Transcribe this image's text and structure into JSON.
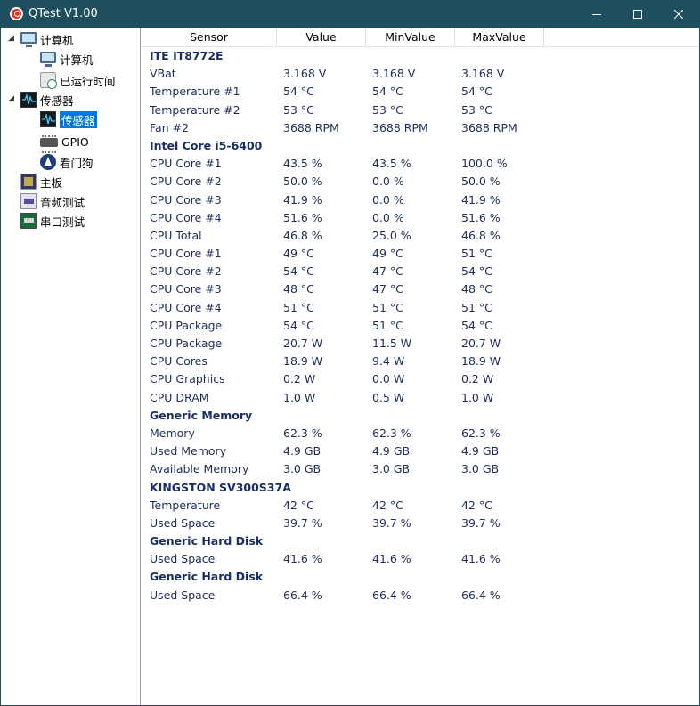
{
  "window": {
    "title": "QTest V1.00",
    "minimize_symbol": "",
    "maximize_symbol": "",
    "close_symbol": ""
  },
  "tree": [
    {
      "label": "计算机",
      "icon": "monitor-icon",
      "expander": "◢",
      "level": 0,
      "selected": false
    },
    {
      "label": "计算机",
      "icon": "monitor-icon",
      "level": 1,
      "selected": false
    },
    {
      "label": "已运行时间",
      "icon": "clock-icon",
      "level": 1,
      "selected": false
    },
    {
      "label": "传感器",
      "icon": "sensor-icon",
      "expander": "◢",
      "level": 0,
      "selected": false
    },
    {
      "label": "传感器",
      "icon": "sensor-icon",
      "level": 1,
      "selected": true
    },
    {
      "label": "GPIO",
      "icon": "chip-icon",
      "level": 1,
      "selected": false
    },
    {
      "label": "看门狗",
      "icon": "watchdog-icon",
      "level": 1,
      "selected": false
    },
    {
      "label": "主板",
      "icon": "mainboard-icon",
      "level": 0,
      "selected": false
    },
    {
      "label": "音频测试",
      "icon": "audio-icon",
      "level": 0,
      "selected": false
    },
    {
      "label": "串口测试",
      "icon": "serial-port-icon",
      "level": 0,
      "selected": false
    }
  ],
  "table": {
    "columns": [
      "Sensor",
      "Value",
      "MinValue",
      "MaxValue"
    ],
    "rows": [
      {
        "group": "ITE IT8772E"
      },
      {
        "cells": [
          "VBat",
          "3.168 V",
          "3.168 V",
          "3.168 V"
        ]
      },
      {
        "cells": [
          "Temperature #1",
          "54 °C",
          "54 °C",
          "54 °C"
        ]
      },
      {
        "cells": [
          "Temperature #2",
          "53 °C",
          "53 °C",
          "53 °C"
        ]
      },
      {
        "cells": [
          "Fan #2",
          "3688 RPM",
          "3688 RPM",
          "3688 RPM"
        ]
      },
      {
        "group": "Intel Core i5-6400"
      },
      {
        "cells": [
          "CPU Core #1",
          "43.5 %",
          "43.5 %",
          "100.0 %"
        ]
      },
      {
        "cells": [
          "CPU Core #2",
          "50.0 %",
          "0.0 %",
          "50.0 %"
        ]
      },
      {
        "cells": [
          "CPU Core #3",
          "41.9 %",
          "0.0 %",
          "41.9 %"
        ]
      },
      {
        "cells": [
          "CPU Core #4",
          "51.6 %",
          "0.0 %",
          "51.6 %"
        ]
      },
      {
        "cells": [
          "CPU Total",
          "46.8 %",
          "25.0 %",
          "46.8 %"
        ]
      },
      {
        "cells": [
          "CPU Core #1",
          "49 °C",
          "49 °C",
          "51 °C"
        ]
      },
      {
        "cells": [
          "CPU Core #2",
          "54 °C",
          "47 °C",
          "54 °C"
        ]
      },
      {
        "cells": [
          "CPU Core #3",
          "48 °C",
          "47 °C",
          "48 °C"
        ]
      },
      {
        "cells": [
          "CPU Core #4",
          "51 °C",
          "51 °C",
          "51 °C"
        ]
      },
      {
        "cells": [
          "CPU Package",
          "54 °C",
          "51 °C",
          "54 °C"
        ]
      },
      {
        "cells": [
          "CPU Package",
          "20.7 W",
          "11.5 W",
          "20.7 W"
        ]
      },
      {
        "cells": [
          "CPU Cores",
          "18.9 W",
          "9.4 W",
          "18.9 W"
        ]
      },
      {
        "cells": [
          "CPU Graphics",
          "0.2 W",
          "0.0 W",
          "0.2 W"
        ]
      },
      {
        "cells": [
          "CPU DRAM",
          "1.0 W",
          "0.5 W",
          "1.0 W"
        ]
      },
      {
        "group": "Generic Memory"
      },
      {
        "cells": [
          "Memory",
          "62.3 %",
          "62.3 %",
          "62.3 %"
        ]
      },
      {
        "cells": [
          "Used Memory",
          "4.9 GB",
          "4.9 GB",
          "4.9 GB"
        ]
      },
      {
        "cells": [
          "Available Memory",
          "3.0 GB",
          "3.0 GB",
          "3.0 GB"
        ]
      },
      {
        "group": "KINGSTON SV300S37A"
      },
      {
        "cells": [
          "Temperature",
          "42 °C",
          "42 °C",
          "42 °C"
        ]
      },
      {
        "cells": [
          "Used Space",
          "39.7 %",
          "39.7 %",
          "39.7 %"
        ]
      },
      {
        "group": "Generic Hard Disk"
      },
      {
        "cells": [
          "Used Space",
          "41.6 %",
          "41.6 %",
          "41.6 %"
        ]
      },
      {
        "group": "Generic Hard Disk"
      },
      {
        "cells": [
          "Used Space",
          "66.4 %",
          "66.4 %",
          "66.4 %"
        ]
      }
    ]
  },
  "colors": {
    "titlebar": "#1f4e5f",
    "selection": "#0078d7",
    "value_text": "#1c2d5a",
    "group_text": "#1a2e66"
  }
}
